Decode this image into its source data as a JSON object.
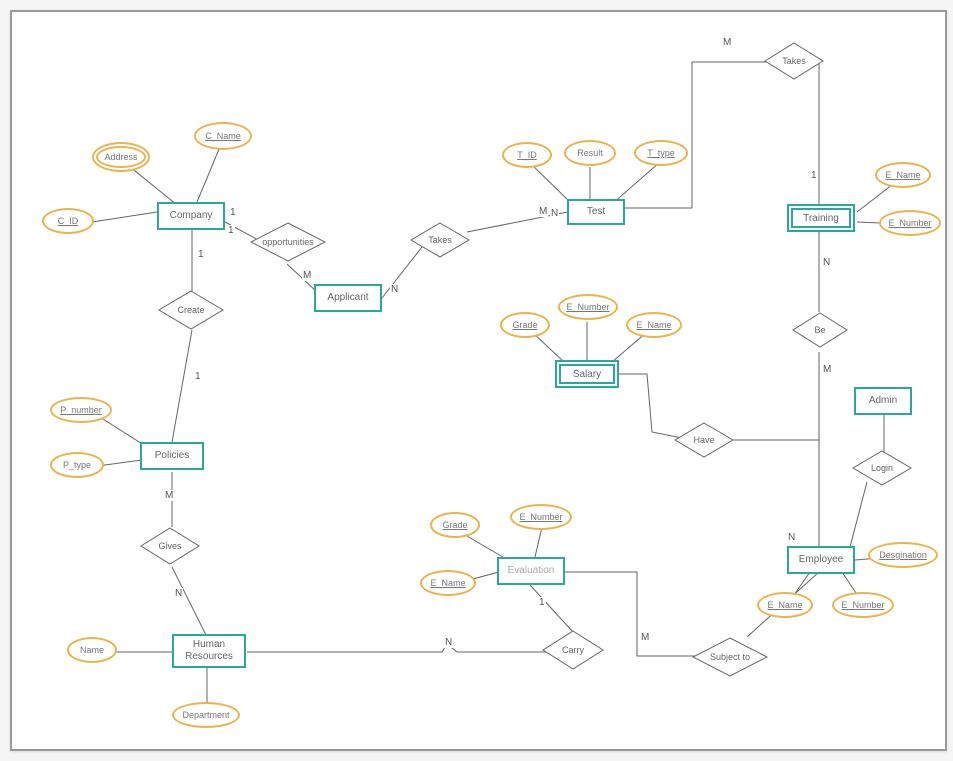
{
  "chart_data": {
    "type": "er-diagram",
    "entities": [
      {
        "id": "company",
        "label": "Company",
        "weak": false,
        "attributes": [
          {
            "name": "C_ID",
            "key": true
          },
          {
            "name": "C_Name",
            "key": true
          },
          {
            "name": "Address",
            "multivalued": true
          }
        ]
      },
      {
        "id": "applicant",
        "label": "Applicant",
        "weak": false,
        "attributes": []
      },
      {
        "id": "test",
        "label": "Test",
        "weak": false,
        "attributes": [
          {
            "name": "T_ID",
            "key": true
          },
          {
            "name": "Result"
          },
          {
            "name": "T_type",
            "key": true
          }
        ]
      },
      {
        "id": "training",
        "label": "Training",
        "weak": true,
        "attributes": [
          {
            "name": "E_Name",
            "key": true
          },
          {
            "name": "E_Number",
            "key": true
          }
        ]
      },
      {
        "id": "policies",
        "label": "Policies",
        "weak": false,
        "attributes": [
          {
            "name": "P_number",
            "key": true
          },
          {
            "name": "P_type"
          }
        ]
      },
      {
        "id": "salary",
        "label": "Salary",
        "weak": true,
        "attributes": [
          {
            "name": "Grade",
            "key": true
          },
          {
            "name": "E_Number",
            "key": true
          },
          {
            "name": "E_Name",
            "key": true
          }
        ]
      },
      {
        "id": "admin",
        "label": "Admin",
        "weak": false,
        "attributes": []
      },
      {
        "id": "evaluation",
        "label": "Evaluation",
        "weak": false,
        "attributes": [
          {
            "name": "Grade",
            "key": true
          },
          {
            "name": "E_Name",
            "key": true
          },
          {
            "name": "E_Number",
            "key": true
          }
        ]
      },
      {
        "id": "employee",
        "label": "Employee",
        "weak": false,
        "attributes": [
          {
            "name": "Desgination",
            "key": true
          },
          {
            "name": "E_Name",
            "key": true
          },
          {
            "name": "E_Number",
            "key": true
          }
        ]
      },
      {
        "id": "hr",
        "label": "Human Resources",
        "weak": false,
        "attributes": [
          {
            "name": "Name"
          },
          {
            "name": "Department"
          }
        ]
      }
    ],
    "relationships": [
      {
        "id": "opportunities",
        "label": "opportunities",
        "links": [
          {
            "entity": "company",
            "card": "1"
          },
          {
            "entity": "applicant",
            "card": "M"
          }
        ]
      },
      {
        "id": "create",
        "label": "Create",
        "links": [
          {
            "entity": "company",
            "card": "1"
          },
          {
            "entity": "policies",
            "card": "1"
          }
        ]
      },
      {
        "id": "takes_test",
        "label": "Takes",
        "links": [
          {
            "entity": "applicant",
            "card": "N"
          },
          {
            "entity": "test",
            "card": "M"
          }
        ]
      },
      {
        "id": "takes_training",
        "label": "Takes",
        "links": [
          {
            "entity": "test",
            "card": "M"
          },
          {
            "entity": "training",
            "card": "1"
          }
        ]
      },
      {
        "id": "be",
        "label": "Be",
        "links": [
          {
            "entity": "training",
            "card": "N"
          },
          {
            "entity": "employee",
            "card": "M"
          }
        ]
      },
      {
        "id": "have",
        "label": "Have",
        "links": [
          {
            "entity": "salary"
          },
          {
            "entity": "employee"
          }
        ]
      },
      {
        "id": "login",
        "label": "Login",
        "links": [
          {
            "entity": "admin"
          },
          {
            "entity": "employee"
          }
        ]
      },
      {
        "id": "gives",
        "label": "Gives",
        "links": [
          {
            "entity": "policies",
            "card": "M"
          },
          {
            "entity": "hr",
            "card": "N"
          }
        ]
      },
      {
        "id": "carry",
        "label": "Carry",
        "links": [
          {
            "entity": "hr",
            "card": "N"
          },
          {
            "entity": "evaluation",
            "card": "1"
          }
        ]
      },
      {
        "id": "subject_to",
        "label": "Subject to",
        "links": [
          {
            "entity": "evaluation",
            "card": "M"
          },
          {
            "entity": "employee",
            "card": "N"
          }
        ]
      }
    ]
  },
  "labels": {
    "company": "Company",
    "applicant": "Applicant",
    "test": "Test",
    "training": "Training",
    "policies": "Policies",
    "salary": "Salary",
    "admin": "Admin",
    "evaluation": "Evaluation",
    "employee": "Employee",
    "hr": "Human Resources",
    "opportunities": "opportunities",
    "create": "Create",
    "takes1": "Takes",
    "takes2": "Takes",
    "be": "Be",
    "have": "Have",
    "login": "Login",
    "gives": "Gives",
    "carry": "Carry",
    "subject_to": "Subject to",
    "address": "Address",
    "c_name": "C_Name",
    "c_id": "C_ID",
    "t_id": "T_ID",
    "result": "Result",
    "t_type": "T_type",
    "e_name_tr": "E_Name",
    "e_number_tr": "E_Number",
    "p_number": "P_number",
    "p_type": "P_type",
    "grade_sal": "Grade",
    "e_number_sal": "E_Number",
    "e_name_sal": "E_Name",
    "grade_eval": "Grade",
    "e_name_eval": "E_Name",
    "e_number_eval": "E_Number",
    "designation": "Desgination",
    "e_name_emp": "E_Name",
    "e_number_emp": "E_Number",
    "name_hr": "Name",
    "department_hr": "Department"
  },
  "cardinalities": {
    "c1": "1",
    "c2": "1",
    "c3": "1",
    "c4": "M",
    "c5": "N",
    "c6": "M",
    "c7": "N",
    "c8": "M",
    "c9": "1",
    "c10": "N",
    "c11": "M",
    "c12": "M",
    "c13": "N",
    "c14": "N",
    "c15": "1",
    "c16": "M",
    "c17": "N"
  }
}
